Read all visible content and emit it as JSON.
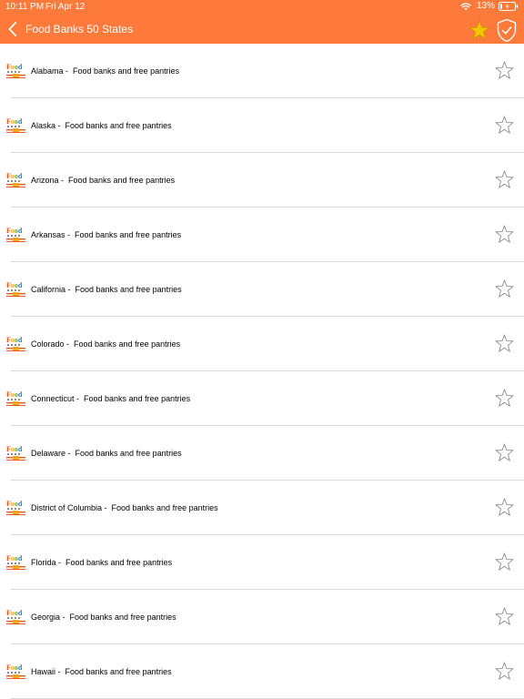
{
  "status_bar": {
    "time": "10:11 PM",
    "date": "Fri Apr 12",
    "battery_percent": "13%",
    "battery_level": 0.13,
    "wifi": "wifi-icon"
  },
  "nav": {
    "title": "Food Banks 50 States",
    "back_icon": "chevron-left-icon",
    "favorites_icon": "star-filled-icon",
    "shield_icon": "shield-check-icon"
  },
  "colors": {
    "header_bg": "#fd7a3a",
    "favorite_star": "#f5c400",
    "separator": "#d9d9d9",
    "star_outline": "#8a8a8a"
  },
  "list": {
    "items": [
      {
        "label": "Alabama -  Food banks and free pantries",
        "favorite": false
      },
      {
        "label": "Alaska -  Food banks and free pantries",
        "favorite": false
      },
      {
        "label": "Arizona -  Food banks and free pantries",
        "favorite": false
      },
      {
        "label": "Arkansas -  Food banks and free pantries",
        "favorite": false
      },
      {
        "label": "California -  Food banks and free pantries",
        "favorite": false
      },
      {
        "label": "Colorado -  Food banks and free pantries",
        "favorite": false
      },
      {
        "label": "Connecticut -  Food banks and free pantries",
        "favorite": false
      },
      {
        "label": "Delaware -  Food banks and free pantries",
        "favorite": false
      },
      {
        "label": "District of Columbia -  Food banks and free pantries",
        "favorite": false
      },
      {
        "label": "Florida -  Food banks and free pantries",
        "favorite": false
      },
      {
        "label": "Georgia -  Food banks and free pantries",
        "favorite": false
      },
      {
        "label": "Hawaii -  Food banks and free pantries",
        "favorite": false
      }
    ],
    "item_logo_icon": "food-bank-usa-logo",
    "item_star_icon": "star-outline-icon"
  }
}
